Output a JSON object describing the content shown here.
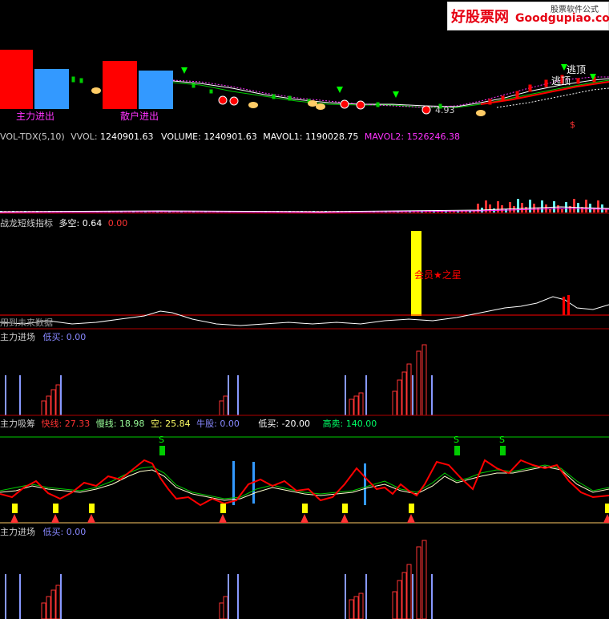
{
  "watermark": {
    "logo": "好股票网",
    "domain": "Goodgupiao.com",
    "tag": "股票软件公式"
  },
  "colors": {
    "red": "#ff0000",
    "blue": "#3399ff",
    "yellow": "#ffff00",
    "green": "#00cc00",
    "violet": "#8888ff",
    "magenta": "#ff33ff",
    "white": "#ffffff"
  },
  "panel_main": {
    "label_zhuli": "主力进出",
    "label_sanhu": "散户进出",
    "label_taoding1": "逃顶",
    "label_taoding2": "逃顶",
    "price_low": "4.93",
    "dollar": "$"
  },
  "panel_vol": {
    "name": "VOL-TDX(5,10)",
    "vvol_label": "VVOL:",
    "vvol": "1240901.63",
    "volume_label": "VOLUME:",
    "volume": "1240901.63",
    "mavol1_label": "MAVOL1:",
    "mavol1": "1190028.75",
    "mavol2_label": "MAVOL2:",
    "mavol2": "1526246.38"
  },
  "panel_dragon": {
    "name": "战龙短线指标",
    "duokong_label": "多空:",
    "duokong": "0.64",
    "second_val": "0.00",
    "member_label": "会员★之星",
    "future_note": "用到未来数据"
  },
  "panel_entry1": {
    "name": "主力进场",
    "dimai_label": "低买:",
    "dimai": "0.00"
  },
  "panel_absorb": {
    "name": "主力吸筹",
    "kuai_label": "快线:",
    "kuai": "27.33",
    "man_label": "慢线:",
    "man": "18.98",
    "kong_label": "空:",
    "kong": "25.84",
    "niugu_label": "牛股:",
    "niugu": "0.00",
    "dimai_label": "低买:",
    "dimai": "-20.00",
    "gaomai_label": "高卖:",
    "gaomai": "140.00",
    "s_mark": "S"
  },
  "panel_entry2": {
    "name": "主力进场",
    "dimai_label": "低买:",
    "dimai": "0.00"
  }
}
